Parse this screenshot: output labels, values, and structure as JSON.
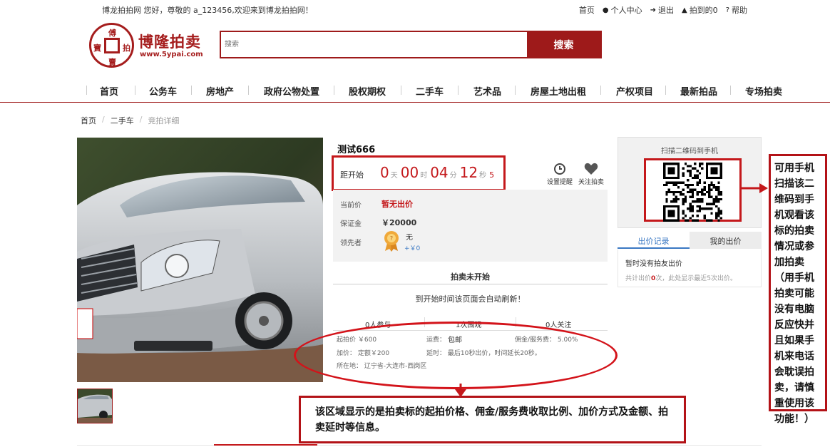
{
  "topbar": {
    "welcome": "博龙拍拍网 您好，尊敬的 a_123456,欢迎来到博龙拍拍网！",
    "links": [
      {
        "label": "首页",
        "icon": ""
      },
      {
        "label": "个人中心",
        "icon": "user-icon"
      },
      {
        "label": "退出",
        "icon": "logout-icon"
      },
      {
        "label": "拍到的0",
        "icon": "trophy-icon"
      },
      {
        "label": "帮助",
        "icon": "help-icon"
      }
    ]
  },
  "logo": {
    "name": "博隆拍卖",
    "url": "www.5ypai.com",
    "seal_chars": [
      "傅",
      "寶",
      "拍",
      "賣"
    ]
  },
  "search": {
    "placeholder": "搜索",
    "button": "搜索"
  },
  "nav": [
    "首页",
    "公务车",
    "房地产",
    "政府公物处置",
    "股权期权",
    "二手车",
    "艺术品",
    "房屋土地出租",
    "产权项目",
    "最新拍品",
    "专场拍卖"
  ],
  "breadcrumb": {
    "home": "首页",
    "sep": "/",
    "category": "二手车",
    "current": "竞拍详细"
  },
  "lot": {
    "title": "测试666",
    "countdown": {
      "label": "距开始",
      "days": "0",
      "days_unit": "天",
      "hours": "00",
      "hours_unit": "时",
      "minutes": "04",
      "minutes_unit": "分",
      "seconds": "12",
      "seconds_unit": "秒",
      "sub": "5"
    },
    "remind": "设置提醒",
    "follow": "关注拍卖",
    "current_price_label": "当前价",
    "current_price": "暂无出价",
    "deposit_label": "保证金",
    "deposit": "￥20000",
    "leader_label": "领先者",
    "leader": "无",
    "leader_bid": "+￥0",
    "status": "拍卖未开始",
    "notice": "到开始时间该页面会自动刷新！",
    "stats": [
      "0人参与",
      "1次围观",
      "0人关注"
    ],
    "details": {
      "start_price": "起拍价 ￥600",
      "shipping_label": "运费：",
      "shipping": "包邮",
      "commission": "佣金/服务费： 5.00%",
      "increment": "加价： 定额￥200",
      "delay": "延时： 最后10秒出价，时间延长20秒。",
      "location": "所在地： 辽宁省-大连市-西岗区"
    }
  },
  "sidebar": {
    "qr_caption": "扫描二维码到手机",
    "tab_active": "出价记录",
    "tab_other": "我的出价",
    "empty": "暂时没有拍友出价",
    "summary_pre": "共计出价",
    "summary_count": "0",
    "summary_post": "次，此处显示最近5次出价。"
  },
  "annotations": {
    "right": "可用手机扫描该二维码到手机观看该标的拍卖情况或参加拍卖（用手机拍卖可能没有电脑反应快并且如果手机来电话会耽误拍卖，请慎重使用该功能！）",
    "bottom": "该区域显示的是拍卖标的起拍价格、佣金/服务费收取比例、加价方式及金额、拍卖延时等信息。"
  },
  "colors": {
    "brand": "#9e1a1a",
    "highlight": "#c4181b",
    "link": "#3a78c3"
  }
}
